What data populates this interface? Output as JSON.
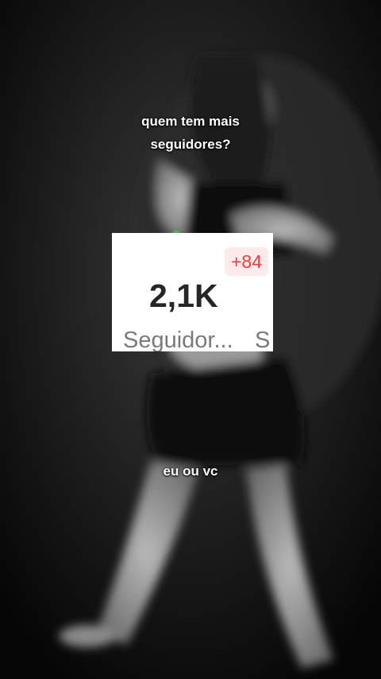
{
  "captions": {
    "top_line1": "quem tem mais",
    "top_line2": "seguidores?",
    "bottom": "eu ou vc"
  },
  "stats_card": {
    "count": "2,1K",
    "badge": "+84",
    "label": "Seguidor...",
    "next_label_partial": "S"
  },
  "colors": {
    "badge_text": "#ef3b3b",
    "badge_bg": "#fdeaea",
    "count_text": "#262626",
    "label_text": "#7a7a7a"
  }
}
